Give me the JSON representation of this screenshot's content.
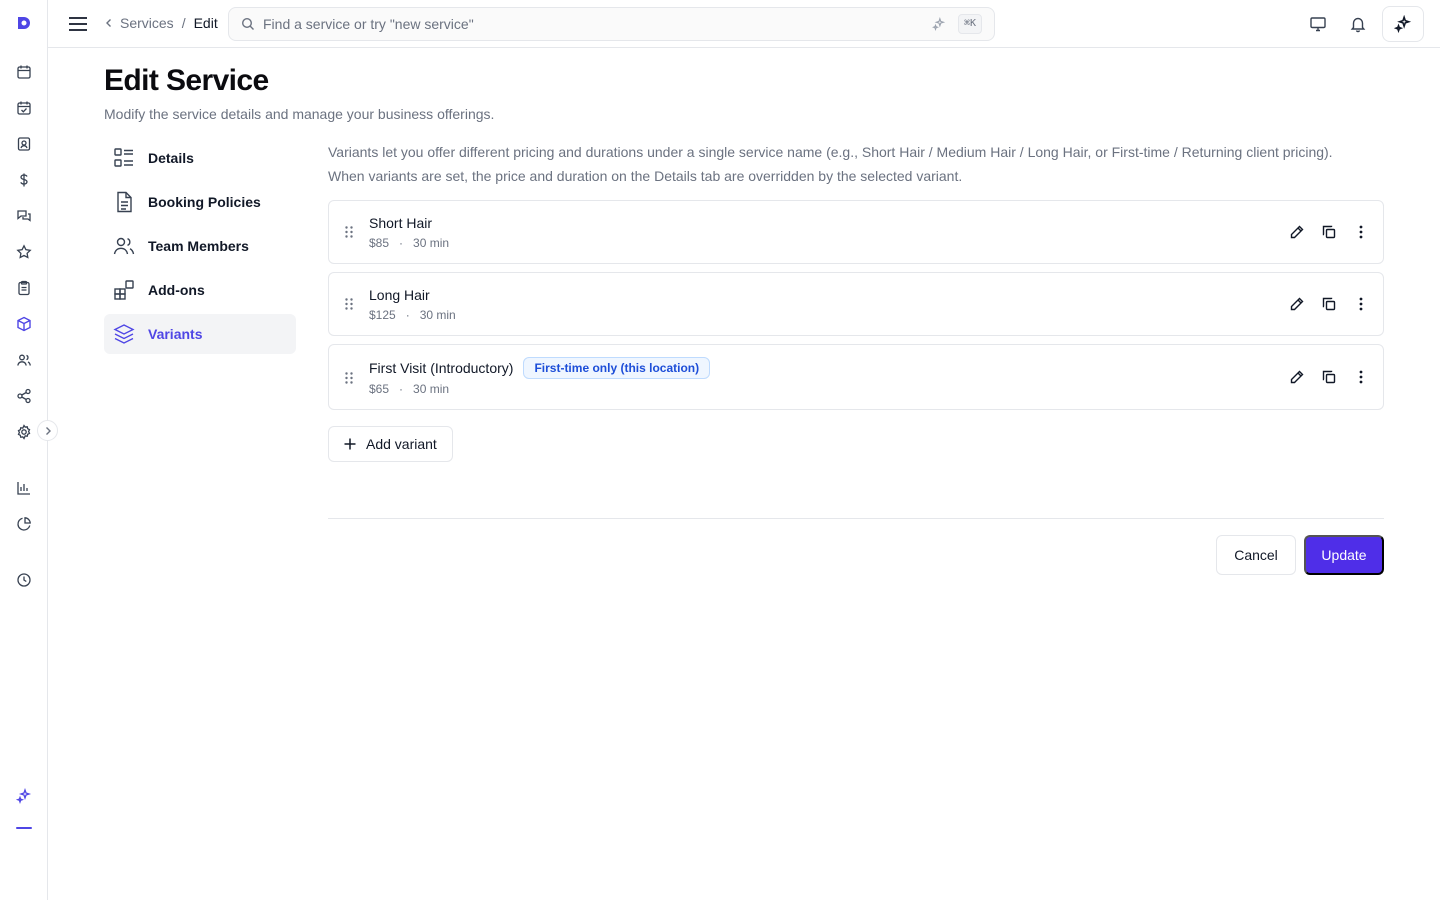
{
  "app": {
    "brand_color": "#4f46e5",
    "rail_icons": [
      "logo-icon",
      "calendar-icon",
      "calendar-check-icon",
      "contact-card-icon",
      "dollar-icon",
      "chat-icon",
      "star-icon",
      "clipboard-icon",
      "cube-icon",
      "users-icon",
      "share-icon",
      "settings-icon",
      "bar-chart-icon",
      "pie-chart-icon",
      "clock-icon",
      "sparkles-icon"
    ]
  },
  "header": {
    "breadcrumb_parent": "Services",
    "breadcrumb_sep": "/",
    "breadcrumb_current": "Edit",
    "search_placeholder": "Find a service or try \"new service\"",
    "search_shortcut": "⌘K"
  },
  "page": {
    "title": "Edit Service",
    "subtitle": "Modify the service details and manage your business offerings."
  },
  "sections": [
    {
      "label": "Details",
      "icon": "details-icon",
      "active": false
    },
    {
      "label": "Booking Policies",
      "icon": "document-icon",
      "active": false
    },
    {
      "label": "Team Members",
      "icon": "users-icon",
      "active": false
    },
    {
      "label": "Add-ons",
      "icon": "addons-icon",
      "active": false
    },
    {
      "label": "Variants",
      "icon": "layers-icon",
      "active": true
    }
  ],
  "variants_panel": {
    "intro_line1": "Variants let you offer different pricing and durations under a single service name (e.g., Short Hair / Medium Hair / Long Hair, or First-time / Returning client pricing).",
    "intro_line2": "When variants are set, the price and duration on the Details tab are overridden by the selected variant.",
    "items": [
      {
        "name": "Short Hair",
        "price": "$85",
        "sep": "·",
        "duration": "30 min",
        "badge": ""
      },
      {
        "name": "Long Hair",
        "price": "$125",
        "sep": "·",
        "duration": "30 min",
        "badge": ""
      },
      {
        "name": "First Visit (Introductory)",
        "price": "$65",
        "sep": "·",
        "duration": "30 min",
        "badge": "First-time only (this location)"
      }
    ],
    "add_label": "Add variant"
  },
  "footer": {
    "cancel_label": "Cancel",
    "update_label": "Update",
    "update_color": "#4f2ee8"
  }
}
